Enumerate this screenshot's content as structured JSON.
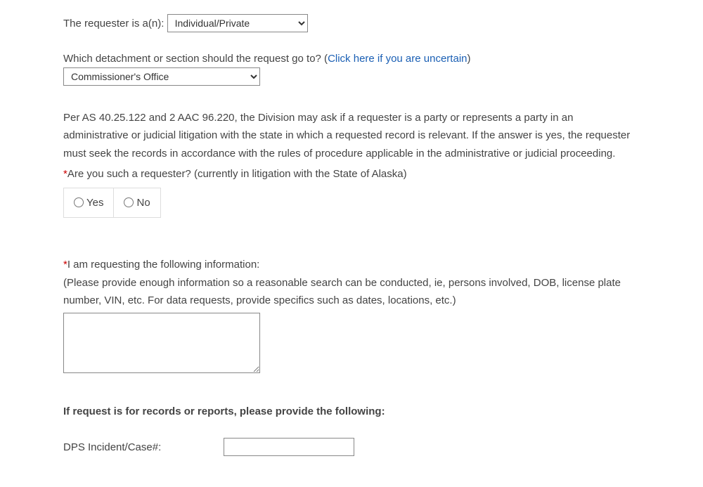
{
  "requesterLabel": "The requester is a(n):",
  "requesterValue": "Individual/Private",
  "detachmentLabel": "Which detachment or section should the request go to? (",
  "detachmentLink": "Click here if you are uncertain",
  "detachmentLabelEnd": ")",
  "detachmentValue": "Commissioner's Office",
  "litigationParagraph": "Per AS 40.25.122 and 2 AAC 96.220, the Division may ask if a requester is a party or represents a party in an administrative or judicial litigation with the state in which a requested record is relevant. If the answer is yes, the requester must seek the records in accordance with the rules of procedure applicable in the administrative or judicial proceeding.",
  "litigationQuestion": "Are you such a requester? (currently in litigation with the State of Alaska)",
  "yesLabel": "Yes",
  "noLabel": "No",
  "requestInfoLabel": "I am requesting the following information:",
  "requestInfoHint": "(Please provide enough information so a reasonable search can be conducted, ie, persons involved, DOB, license plate number, VIN, etc. For data requests, provide specifics such as dates, locations, etc.)",
  "recordsHeader": "If request is for records or reports, please provide the following:",
  "incidentLabel": "DPS Incident/Case#:"
}
